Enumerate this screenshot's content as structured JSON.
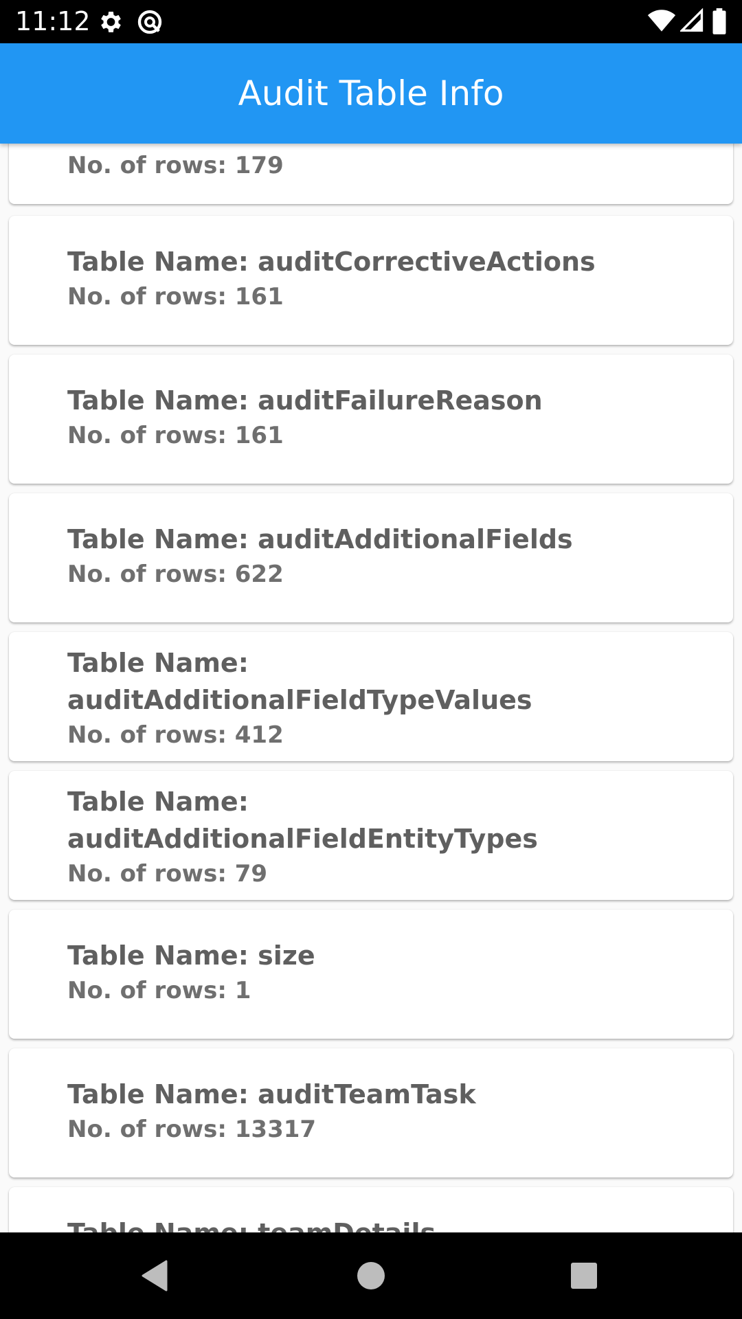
{
  "status_bar": {
    "time": "11:12",
    "icons": [
      "gear-icon",
      "sync-icon",
      "wifi-icon",
      "cell-signal-icon",
      "battery-icon"
    ]
  },
  "app_bar": {
    "title": "Audit Table Info",
    "color": "#2196F3"
  },
  "cards": [
    {
      "name": "",
      "rows": "No. of rows: 179"
    },
    {
      "name": "Table Name: auditCorrectiveActions",
      "rows": "No. of rows: 161"
    },
    {
      "name": "Table Name: auditFailureReason",
      "rows": "No. of rows: 161"
    },
    {
      "name": "Table Name: auditAdditionalFields",
      "rows": "No. of rows: 622"
    },
    {
      "name": "Table Name: auditAdditionalFieldTypeValues",
      "rows": "No. of rows: 412"
    },
    {
      "name": "Table Name: auditAdditionalFieldEntityTypes",
      "rows": "No. of rows: 79"
    },
    {
      "name": "Table Name: size",
      "rows": "No. of rows: 1"
    },
    {
      "name": "Table Name: auditTeamTask",
      "rows": "No. of rows: 13317"
    },
    {
      "name": "Table Name: teamDetails",
      "rows": ""
    }
  ],
  "nav_bar": {
    "buttons": [
      "back-icon",
      "home-icon",
      "recents-icon"
    ]
  }
}
